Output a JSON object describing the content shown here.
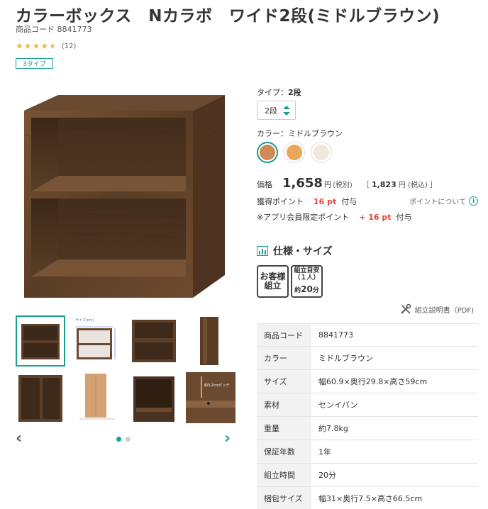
{
  "product": {
    "title": "カラーボックス　Nカラボ　ワイド2段(ミドルブラウン)",
    "code_line": "商品コード 8841773",
    "rating": 4.5,
    "rating_count": "(12)",
    "type_badge": "3タイプ"
  },
  "gallery": {
    "thumb_count": 8,
    "active_index": 0,
    "prev_label": "‹",
    "next_label": "›",
    "page_count": 2,
    "active_page": 0,
    "thumb_texts": {
      "size_title": "サイズ(cm)",
      "height_note": "約3.2cmピッチ"
    }
  },
  "options": {
    "type_label": "タイプ：",
    "type_value": "2段",
    "select_value": "2段",
    "color_label": "カラー：",
    "color_value": "ミドルブラウン",
    "swatches": [
      {
        "name": "ミドルブラウン",
        "color": "#d08a55",
        "active": true
      },
      {
        "name": "ナチュラル",
        "color": "#e8a85a",
        "active": false
      },
      {
        "name": "ホワイト",
        "color": "#efe8dc",
        "active": false
      }
    ]
  },
  "price": {
    "label": "価格",
    "value": "1,658",
    "unit": "円",
    "tax_note": "(税別)",
    "incl_open": "［",
    "incl_value": "1,823",
    "incl_unit": "円",
    "incl_note": "(税込)",
    "incl_close": "］"
  },
  "points": {
    "label": "獲得ポイント",
    "value": "16 pt",
    "suffix": "付与",
    "about": "ポイントについて",
    "app_label": "※アプリ会員限定ポイント",
    "app_value": "+ 16 pt",
    "app_suffix": "付与"
  },
  "spec": {
    "heading": "仕様・サイズ",
    "badge1_line1": "お客様",
    "badge1_line2": "組立",
    "badge2_line1": "組立目安",
    "badge2_line2": "（１人）",
    "badge2_line3_pre": "約",
    "badge2_line3_num": "20",
    "badge2_line3_unit": "分",
    "manual_label": "組立説明書（PDF)",
    "rows": [
      {
        "k": "商品コード",
        "v": "8841773"
      },
      {
        "k": "カラー",
        "v": "ミドルブラウン"
      },
      {
        "k": "サイズ",
        "v": "幅60.9×奥行29.8×高さ59cm"
      },
      {
        "k": "素材",
        "v": "センイバン"
      },
      {
        "k": "重量",
        "v": "約7.8kg"
      },
      {
        "k": "保証年数",
        "v": "1年"
      },
      {
        "k": "組立時間",
        "v": "20分"
      },
      {
        "k": "梱包サイズ",
        "v": "幅31×奥行7.5×高さ66.5cm"
      }
    ]
  },
  "colors": {
    "accent": "#1a9e8f",
    "price_red": "#e8453c",
    "wood_dark": "#4a3222",
    "wood_mid": "#6b4a30"
  }
}
